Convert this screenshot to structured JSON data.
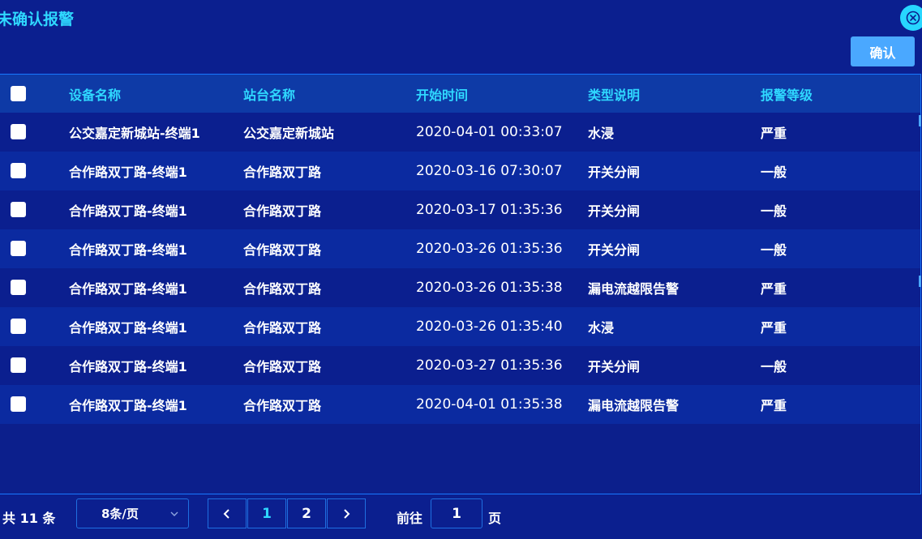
{
  "title": "未确认报警",
  "actions": {
    "confirm_label": "确认"
  },
  "icons": {
    "close": "close-icon",
    "checkbox": "checkbox-icon",
    "chevron_down": "chevron-down-icon",
    "prev": "chevron-left-icon",
    "next": "chevron-right-icon"
  },
  "colors": {
    "background": "#0b1f8f",
    "accent": "#2fd8ff",
    "button": "#4aa8ff",
    "border": "#1f6fe0"
  },
  "table": {
    "headers": [
      "设备名称",
      "站台名称",
      "开始时间",
      "类型说明",
      "报警等级"
    ],
    "rows": [
      [
        "公交嘉定新城站-终端1",
        "公交嘉定新城站",
        "2020-04-01 00:33:07",
        "水浸",
        "严重"
      ],
      [
        "合作路双丁路-终端1",
        "合作路双丁路",
        "2020-03-16 07:30:07",
        "开关分闸",
        "一般"
      ],
      [
        "合作路双丁路-终端1",
        "合作路双丁路",
        "2020-03-17 01:35:36",
        "开关分闸",
        "一般"
      ],
      [
        "合作路双丁路-终端1",
        "合作路双丁路",
        "2020-03-26 01:35:36",
        "开关分闸",
        "一般"
      ],
      [
        "合作路双丁路-终端1",
        "合作路双丁路",
        "2020-03-26 01:35:38",
        "漏电流越限告警",
        "严重"
      ],
      [
        "合作路双丁路-终端1",
        "合作路双丁路",
        "2020-03-26 01:35:40",
        "水浸",
        "严重"
      ],
      [
        "合作路双丁路-终端1",
        "合作路双丁路",
        "2020-03-27 01:35:36",
        "开关分闸",
        "一般"
      ],
      [
        "合作路双丁路-终端1",
        "合作路双丁路",
        "2020-04-01 01:35:38",
        "漏电流越限告警",
        "严重"
      ]
    ]
  },
  "pagination": {
    "total_text": "共 11 条",
    "page_size": "8条/页",
    "pages": [
      "1",
      "2"
    ],
    "current_page": "1",
    "goto_label": "前往",
    "goto_value": "1",
    "page_suffix": "页"
  }
}
